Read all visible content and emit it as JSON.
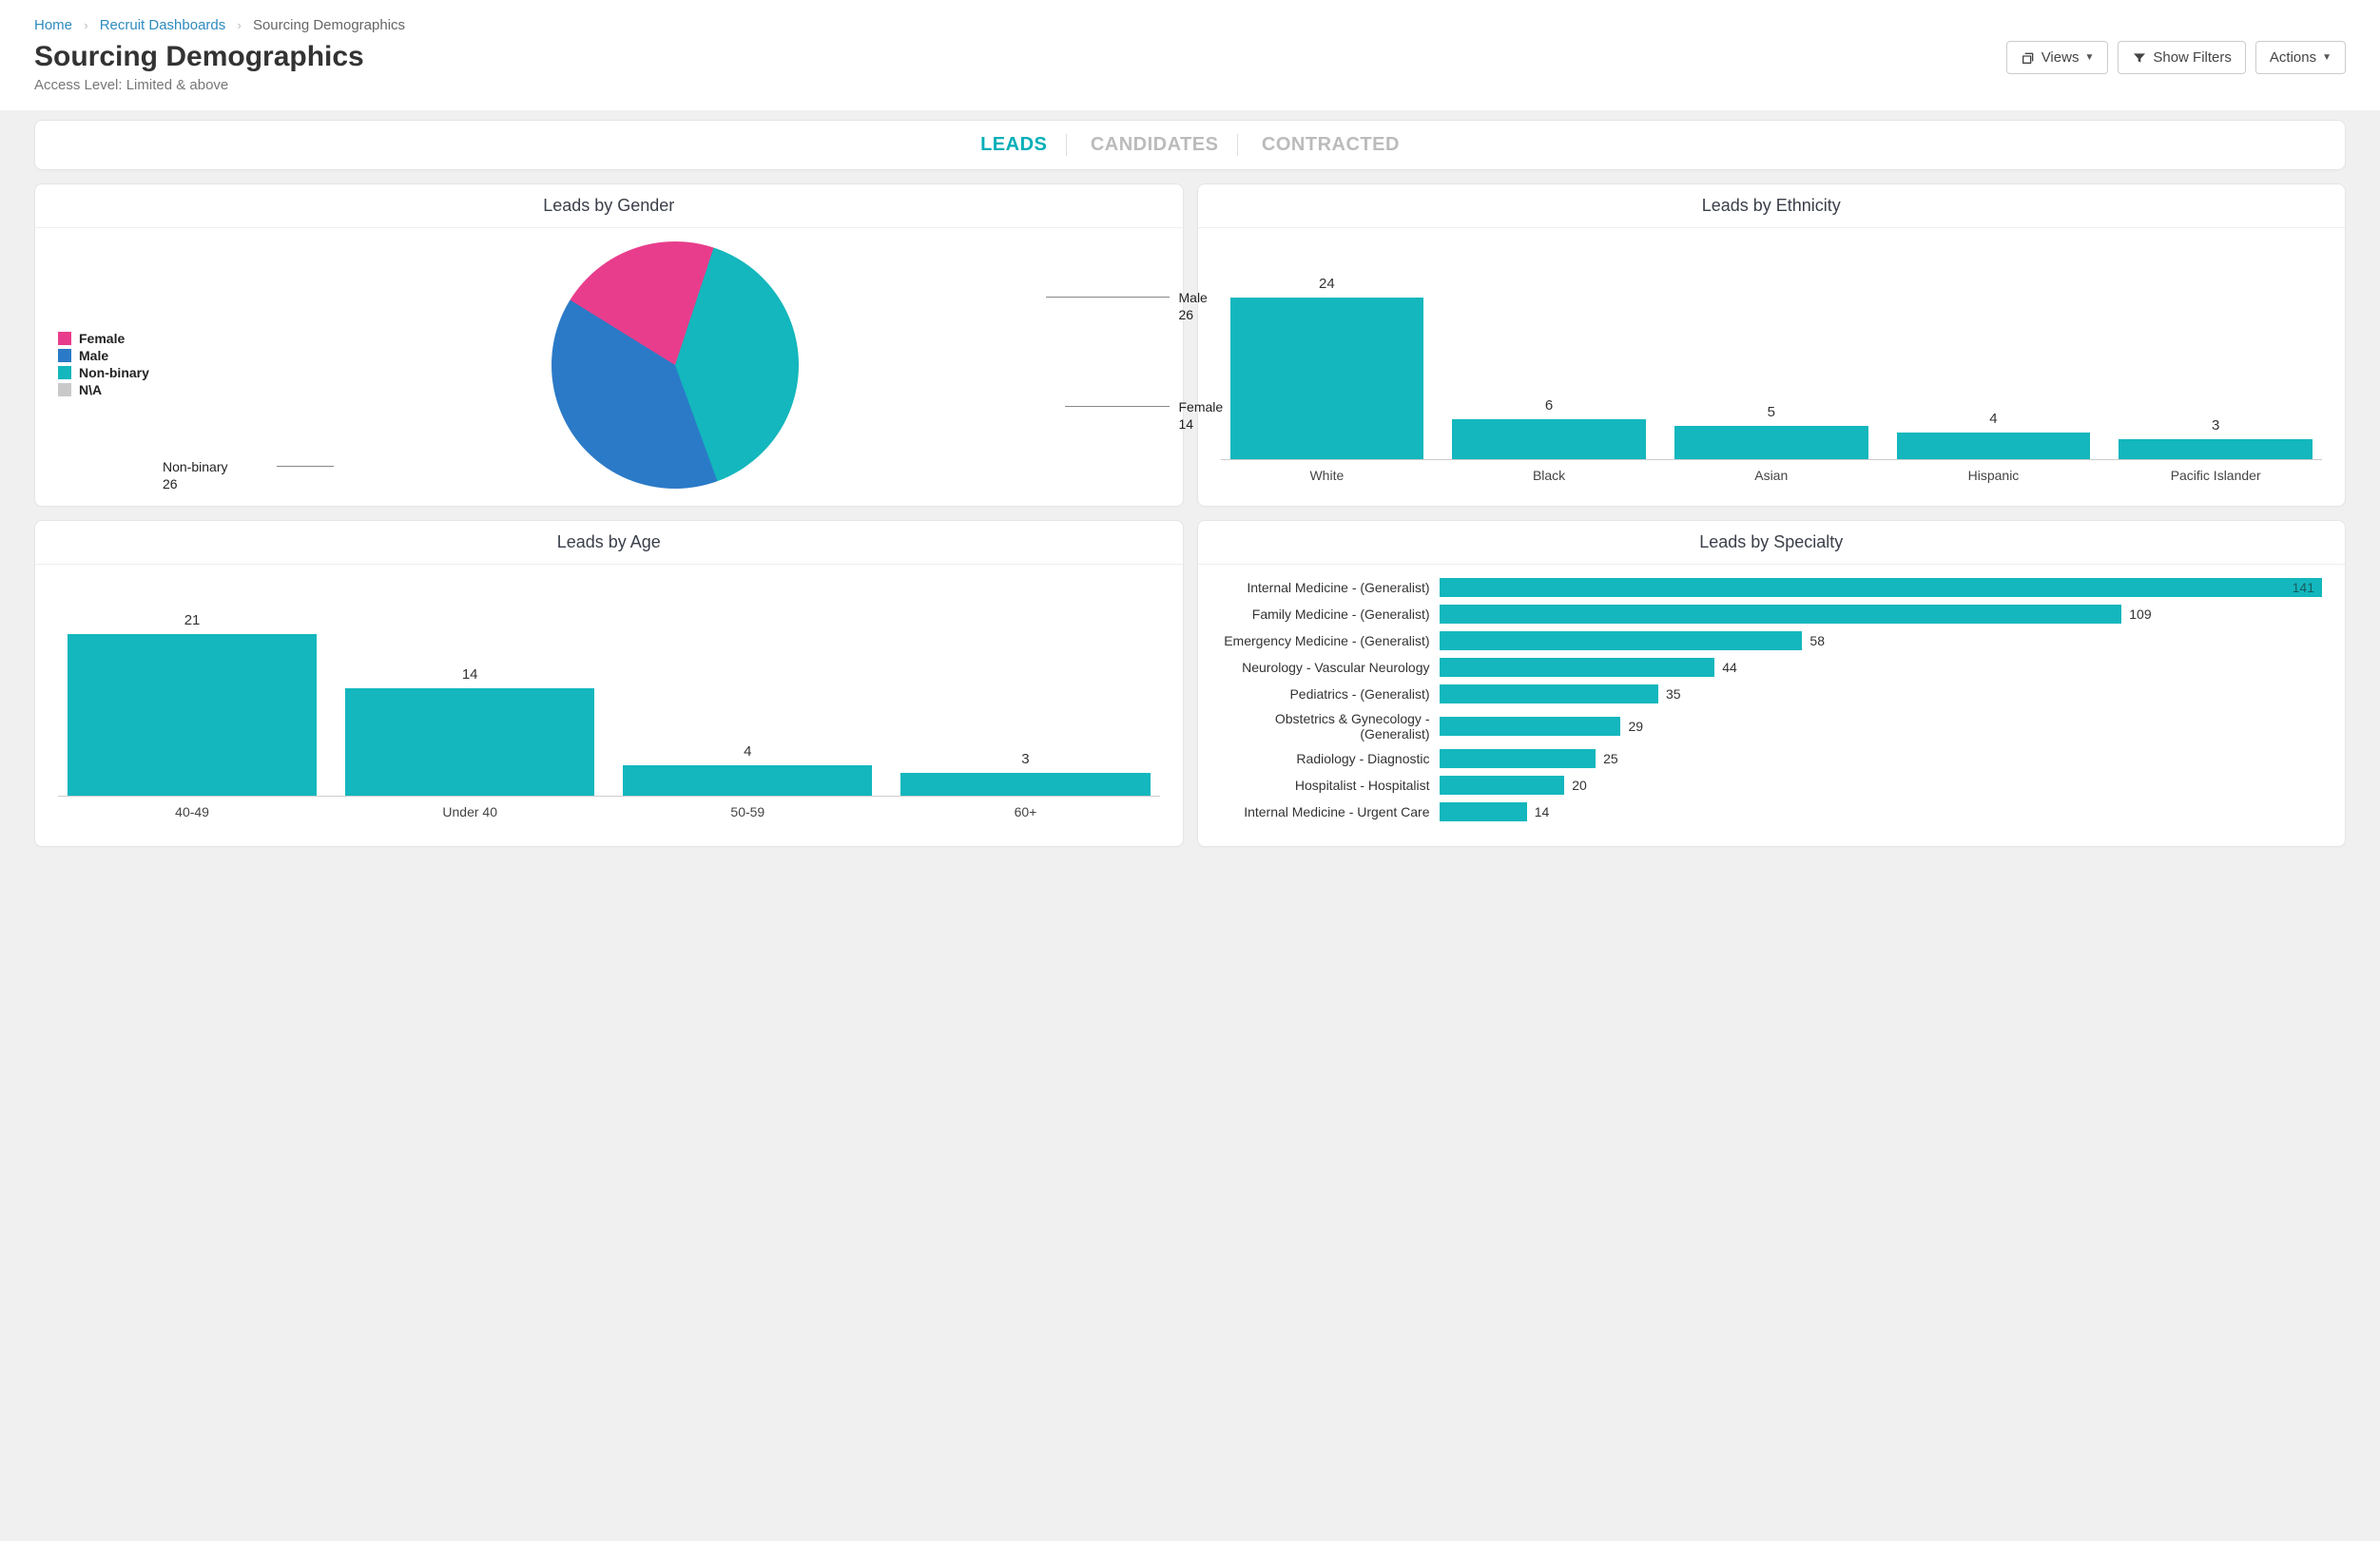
{
  "breadcrumb": {
    "home": "Home",
    "dashboards": "Recruit Dashboards",
    "current": "Sourcing Demographics"
  },
  "page": {
    "title": "Sourcing Demographics",
    "access": "Access Level: Limited & above"
  },
  "buttons": {
    "views": "Views",
    "show_filters": "Show Filters",
    "actions": "Actions"
  },
  "tabs": {
    "leads": "LEADS",
    "candidates": "CANDIDATES",
    "contracted": "CONTRACTED"
  },
  "cards": {
    "gender_title": "Leads by Gender",
    "ethnicity_title": "Leads by Ethnicity",
    "age_title": "Leads by Age",
    "specialty_title": "Leads by Specialty"
  },
  "colors": {
    "teal": "#13b7bd",
    "blue": "#2b7ac7",
    "pink": "#e83d8c",
    "grey": "#c9c9c9",
    "tab_active": "#00aeb8"
  },
  "chart_data": [
    {
      "id": "gender",
      "type": "pie",
      "title": "Leads by Gender",
      "legend": [
        {
          "name": "Female",
          "color": "#e83d8c"
        },
        {
          "name": "Male",
          "color": "#2b7ac7"
        },
        {
          "name": "Non-binary",
          "color": "#13b7bd"
        },
        {
          "name": "N\\A",
          "color": "#c9c9c9"
        }
      ],
      "slices": [
        {
          "name": "Male",
          "value": 26,
          "color": "#2b7ac7"
        },
        {
          "name": "Female",
          "value": 14,
          "color": "#e83d8c"
        },
        {
          "name": "Non-binary",
          "value": 26,
          "color": "#13b7bd"
        }
      ]
    },
    {
      "id": "ethnicity",
      "type": "bar",
      "title": "Leads by Ethnicity",
      "categories": [
        "White",
        "Black",
        "Asian",
        "Hispanic",
        "Pacific Islander"
      ],
      "values": [
        24,
        6,
        5,
        4,
        3
      ],
      "ylim": [
        0,
        24
      ]
    },
    {
      "id": "age",
      "type": "bar",
      "title": "Leads by Age",
      "categories": [
        "40-49",
        "Under 40",
        "50-59",
        "60+"
      ],
      "values": [
        21,
        14,
        4,
        3
      ],
      "ylim": [
        0,
        21
      ]
    },
    {
      "id": "specialty",
      "type": "bar",
      "orientation": "horizontal",
      "title": "Leads by Specialty",
      "categories": [
        "Internal Medicine - (Generalist)",
        "Family Medicine - (Generalist)",
        "Emergency Medicine - (Generalist)",
        "Neurology - Vascular Neurology",
        "Pediatrics - (Generalist)",
        "Obstetrics & Gynecology - (Generalist)",
        "Radiology - Diagnostic",
        "Hospitalist - Hospitalist",
        "Internal Medicine - Urgent Care"
      ],
      "values": [
        141,
        109,
        58,
        44,
        35,
        29,
        25,
        20,
        14
      ],
      "xlim": [
        0,
        141
      ]
    }
  ]
}
